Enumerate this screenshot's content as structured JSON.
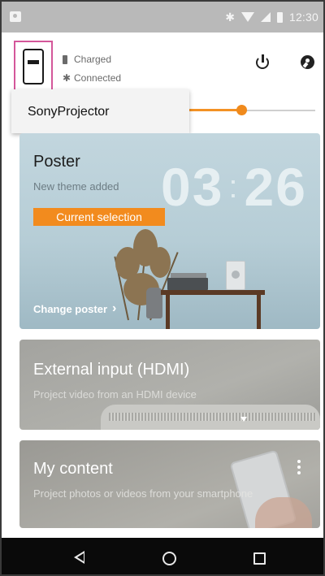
{
  "status_bar": {
    "time": "12:30",
    "icons": [
      "app-notification-icon",
      "bluetooth-icon",
      "wifi-icon",
      "signal-icon",
      "battery-icon"
    ]
  },
  "header": {
    "device_icon": "projector-device-icon",
    "charged_label": "Charged",
    "connected_label": "Connected",
    "power_icon": "power-icon",
    "settings_icon": "settings-wrench-icon",
    "brightness_level": 0.43
  },
  "dropdown": {
    "items": [
      {
        "label": "SonyProjector"
      }
    ]
  },
  "cards": {
    "poster": {
      "title": "Poster",
      "subtitle": "New theme added",
      "badge": "Current selection",
      "clock_hours": "03",
      "clock_separator": ":",
      "clock_minutes": "26",
      "action_label": "Change poster"
    },
    "hdmi": {
      "title": "External input (HDMI)",
      "subtitle": "Project video from an HDMI device"
    },
    "my_content": {
      "title": "My content",
      "subtitle": "Project photos or videos from your smartphone"
    }
  },
  "nav_bar": {
    "icons": [
      "back-icon",
      "home-icon",
      "recents-icon"
    ]
  },
  "colors": {
    "accent": "#f28b1e",
    "highlight_border": "#d4579a",
    "status_bar": "#b9b9b9",
    "nav_bar": "#0a0a0a"
  }
}
